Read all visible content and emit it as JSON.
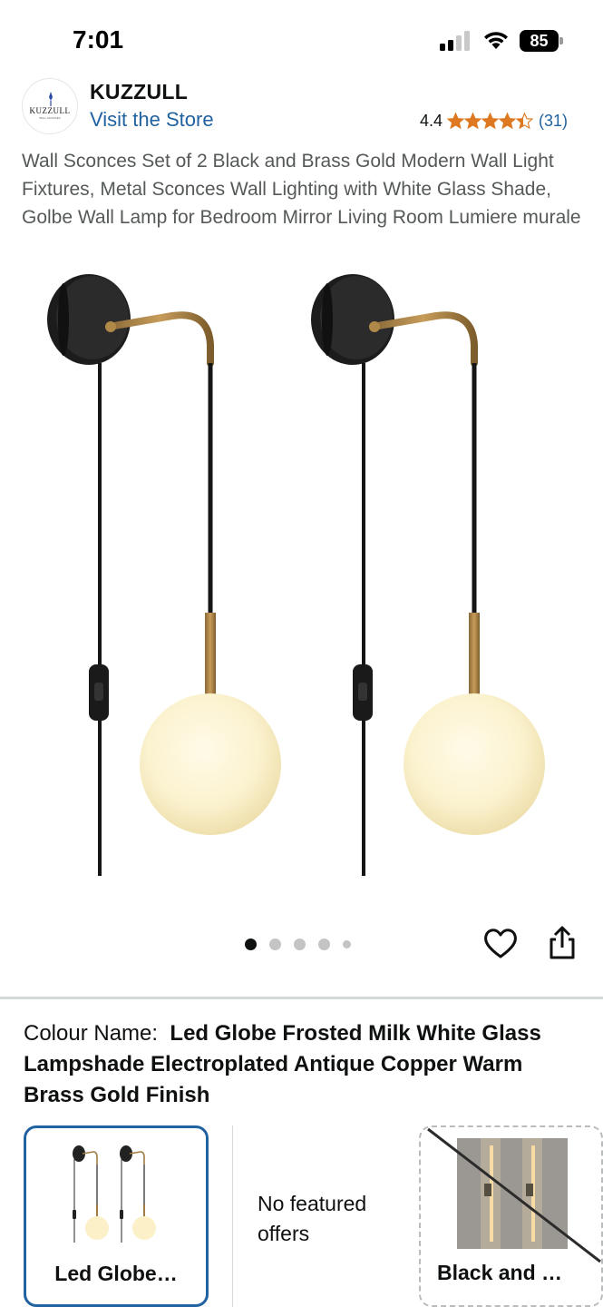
{
  "status_bar": {
    "time": "7:01",
    "battery": "85",
    "icons": [
      "cellular-signal-icon",
      "wifi-icon",
      "battery-icon"
    ]
  },
  "store": {
    "logo_text": "KUZZULL",
    "logo_subtext": "WALL SCONCES",
    "brand": "KUZZULL",
    "visit_link": "Visit the Store",
    "rating": "4.4",
    "stars": 4.4,
    "review_count": "(31)",
    "star_color": "#de7921",
    "link_color": "#2162a1"
  },
  "product": {
    "title": "Wall Sconces Set of 2 Black and Brass Gold Modern Wall Light Fixtures, Metal Sconces Wall Lighting with White Glass Shade, Golbe Wall Lamp for Bedroom Mirror Living Room Lumiere murale",
    "image_icon": "wall-sconce-pair-image",
    "carousel": {
      "total_dots": 5,
      "active_index": 0
    },
    "actions": [
      "heart-icon",
      "share-icon"
    ]
  },
  "colour": {
    "label": "Colour Name:",
    "value": "Led Globe Frosted Milk White Glass Lampshade Electroplated Antique Copper Warm Brass Gold Finish"
  },
  "swatches": {
    "selected_label": "Led Globe…",
    "no_offers": "No featured offers",
    "unavailable_label": "Black and …",
    "selected_border_color": "#2162a1"
  }
}
